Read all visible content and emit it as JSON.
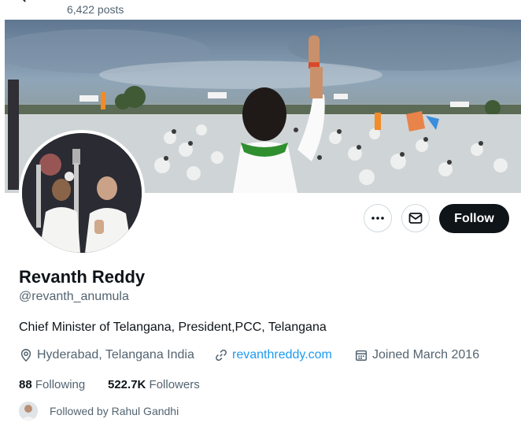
{
  "header": {
    "post_count": "6,422 posts"
  },
  "profile": {
    "display_name": "Revanth Reddy",
    "handle": "@revanth_anumula",
    "bio": "Chief Minister of Telangana, President,PCC, Telangana",
    "location": "Hyderabad, Telangana India",
    "website": "revanthreddy.com",
    "joined": "Joined March 2016",
    "following_count": "88",
    "following_label": "Following",
    "followers_count": "522.7K",
    "followers_label": "Followers",
    "followed_by": "Followed by Rahul Gandhi"
  },
  "actions": {
    "follow_label": "Follow",
    "more_icon": "ellipsis-icon",
    "message_icon": "mail-icon"
  },
  "colors": {
    "link": "#1d9bf0",
    "follow_button": "#0f1419",
    "secondary_text": "#536471"
  }
}
